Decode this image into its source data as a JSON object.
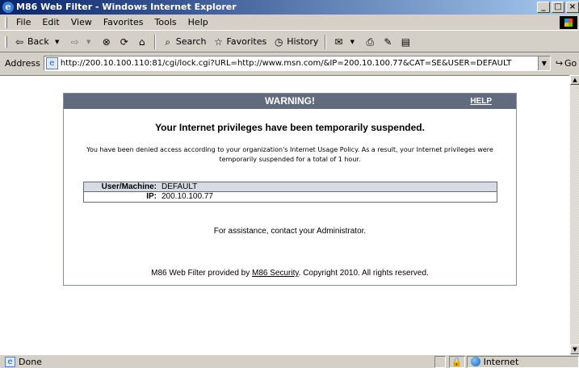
{
  "window": {
    "title": "M86 Web Filter - Windows Internet Explorer",
    "controls": [
      "_",
      "□",
      "×"
    ]
  },
  "menu": [
    "File",
    "Edit",
    "View",
    "Favorites",
    "Tools",
    "Help"
  ],
  "toolbar": {
    "back": "Back",
    "search": "Search",
    "favorites": "Favorites",
    "history": "History"
  },
  "address": {
    "label": "Address",
    "url": "http://200.10.100.110:81/cgi/lock.cgi?URL=http://www.msn.com/&IP=200.10.100.77&CAT=SE&USER=DEFAULT",
    "go": "Go"
  },
  "page": {
    "header_title": "WARNING!",
    "help": "HELP",
    "headline": "Your Internet privileges have been temporarily suspended.",
    "description": "You have been denied access according to your organization's Internet Usage Policy. As a result, your Internet privileges were temporarily suspended for a total of 1 hour.",
    "info": [
      {
        "key": "User/Machine:",
        "value": "DEFAULT"
      },
      {
        "key": "IP:",
        "value": "200.10.100.77"
      }
    ],
    "assistance": "For assistance, contact your Administrator.",
    "footer_prefix": "M86 Web Filter provided by ",
    "footer_link": "M86 Security",
    "footer_suffix": ". Copyright 2010. All rights reserved."
  },
  "status": {
    "text": "Done",
    "zone": "Internet"
  }
}
